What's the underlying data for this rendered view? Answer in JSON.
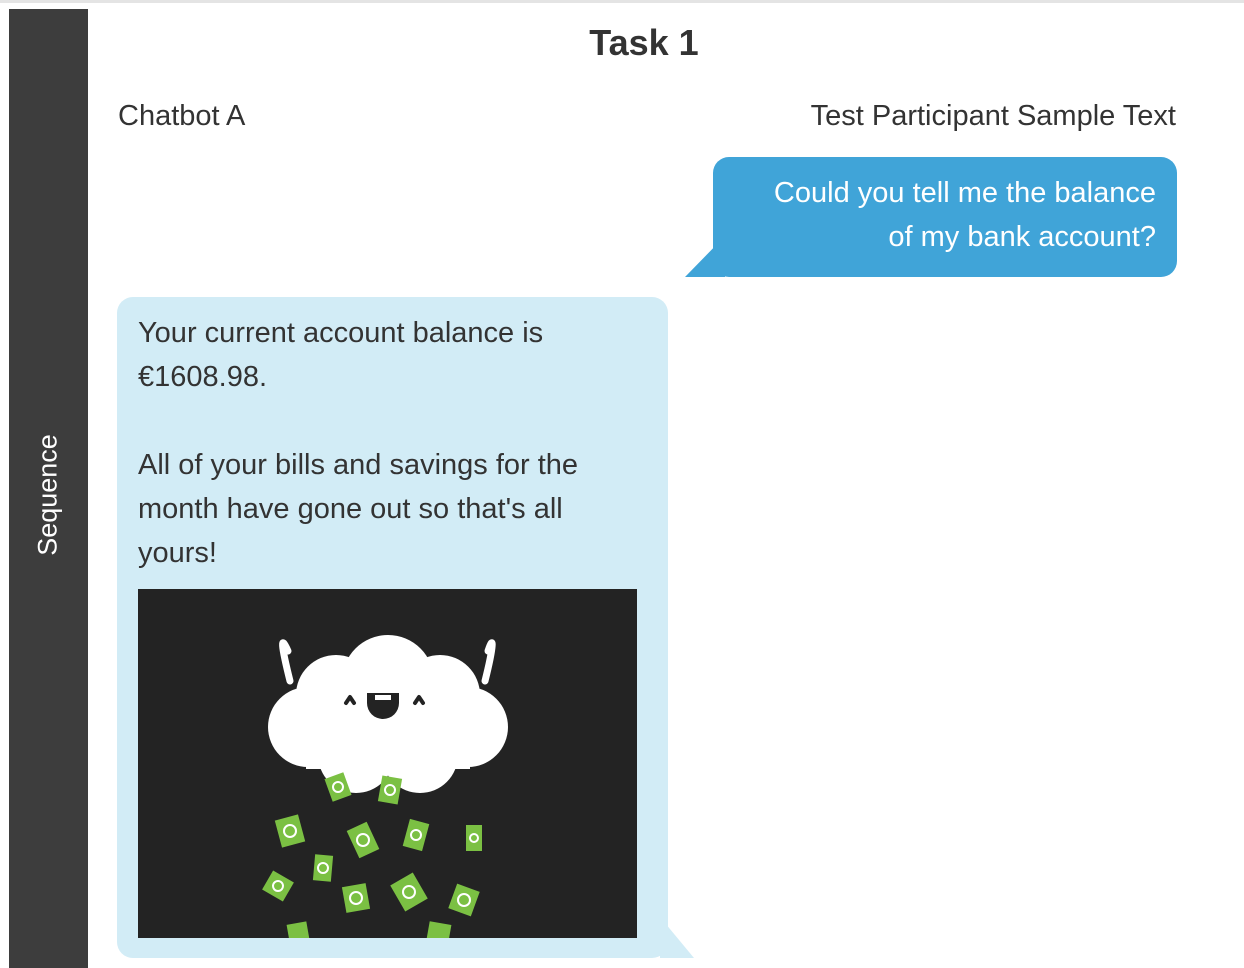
{
  "sidebar": {
    "label": "Sequence"
  },
  "header": {
    "title": "Task 1"
  },
  "participants": {
    "bot_name": "Chatbot A",
    "user_name": "Test Participant Sample Text"
  },
  "messages": {
    "user": {
      "line1": "Could you tell me the balance",
      "line2": "of my bank account?"
    },
    "bot": {
      "p1_line1": "Your current account balance is",
      "p1_line2": "€1608.98.",
      "p2_line1": "All of your bills and savings for the",
      "p2_line2": "month have gone out so that's all",
      "p2_line3": "yours!"
    },
    "image": {
      "description_icon": "happy-cloud-raining-money-icon"
    }
  },
  "colors": {
    "sidebar_bg": "#3d3d3d",
    "user_bubble": "#40a4d8",
    "bot_bubble": "#d2ecf6",
    "image_bg": "#232323",
    "money_green": "#7bc043"
  }
}
